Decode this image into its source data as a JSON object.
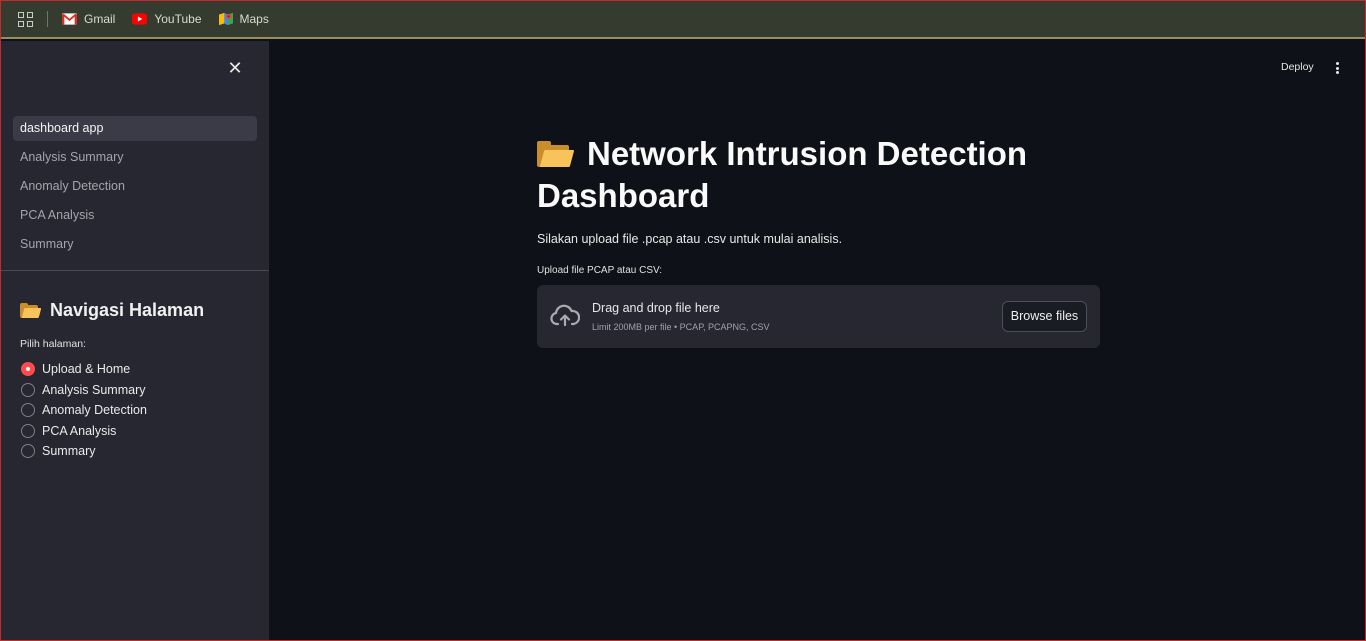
{
  "bookmarks": {
    "items": [
      {
        "label": "Gmail",
        "icon": "gmail-icon"
      },
      {
        "label": "YouTube",
        "icon": "youtube-icon"
      },
      {
        "label": "Maps",
        "icon": "maps-icon"
      }
    ]
  },
  "sidebar": {
    "nav_items": [
      {
        "label": "dashboard app",
        "active": true
      },
      {
        "label": "Analysis Summary",
        "active": false
      },
      {
        "label": "Anomaly Detection",
        "active": false
      },
      {
        "label": "PCA Analysis",
        "active": false
      },
      {
        "label": "Summary",
        "active": false
      }
    ],
    "section_title": "Navigasi Halaman",
    "radio_label": "Pilih halaman:",
    "radio_options": [
      {
        "label": "Upload & Home",
        "checked": true
      },
      {
        "label": "Analysis Summary",
        "checked": false
      },
      {
        "label": "Anomaly Detection",
        "checked": false
      },
      {
        "label": "PCA Analysis",
        "checked": false
      },
      {
        "label": "Summary",
        "checked": false
      }
    ]
  },
  "header": {
    "deploy_label": "Deploy"
  },
  "main": {
    "title": "Network Intrusion Detection Dashboard",
    "subtitle": "Silakan upload file .pcap atau .csv untuk mulai analisis.",
    "upload_label": "Upload file PCAP atau CSV:",
    "dropzone": {
      "main_text": "Drag and drop file here",
      "sub_text": "Limit 200MB per file • PCAP, PCAPNG, CSV",
      "browse_label": "Browse files"
    }
  },
  "colors": {
    "accent": "#ff4b4b",
    "sidebar_bg": "#262730",
    "main_bg": "#0e1117",
    "bookmarks_bg": "#353c2f"
  }
}
